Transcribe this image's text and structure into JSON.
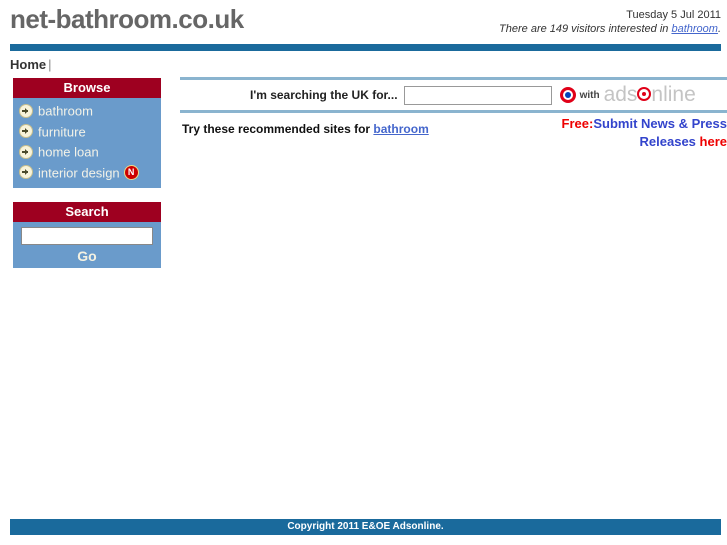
{
  "header": {
    "site_title": "net-bathroom.co.uk",
    "date": "Tuesday 5 Jul 2011",
    "visitors_prefix": "There are 149 visitors interested in ",
    "visitors_keyword": "bathroom",
    "visitors_suffix": "."
  },
  "nav": {
    "home_label": "Home",
    "separator": "|"
  },
  "sidebar": {
    "browse": {
      "title": "Browse",
      "items": [
        {
          "label": "bathroom",
          "badge": ""
        },
        {
          "label": "furniture",
          "badge": ""
        },
        {
          "label": "home loan",
          "badge": ""
        },
        {
          "label": "interior design",
          "badge": "N"
        }
      ]
    },
    "search": {
      "title": "Search",
      "input_value": "",
      "input_placeholder": "",
      "go_label": "Go"
    }
  },
  "main": {
    "search_prompt": "I'm searching the UK for...",
    "search_input_value": "",
    "search_input_placeholder": "",
    "with_label": "with",
    "brand": {
      "part1": "ads",
      "part2": "nline"
    },
    "recommended_prefix": "Try these recommended sites for ",
    "recommended_keyword": "bathroom",
    "promo": {
      "free_label": "Free:",
      "line1": "Submit News & Press",
      "line2": "Releases ",
      "here_label": "here"
    }
  },
  "footer": {
    "copyright": "Copyright 2011 E&OE Adsonline."
  },
  "colors": {
    "bar_blue": "#1a6a9c",
    "panel_header_red": "#9e0020",
    "panel_body_blue": "#6a9bcb",
    "rule_blue": "#8ab4cf",
    "link_blue": "#4466cc",
    "accent_red": "#ee0000"
  }
}
